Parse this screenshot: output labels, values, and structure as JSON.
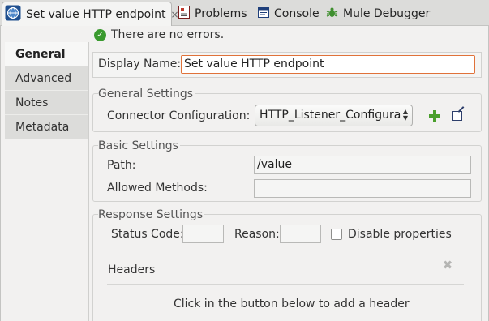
{
  "tabs": [
    {
      "label": "Set value HTTP endpoint",
      "icon": "globe-icon",
      "close": "×"
    },
    {
      "label": "Problems",
      "icon": "problems-icon"
    },
    {
      "label": "Console",
      "icon": "console-icon"
    },
    {
      "label": "Mule Debugger",
      "icon": "bug-icon"
    }
  ],
  "status": {
    "text": "There are no errors.",
    "icon": "check-circle-icon"
  },
  "nav": [
    {
      "label": "General"
    },
    {
      "label": "Advanced"
    },
    {
      "label": "Notes"
    },
    {
      "label": "Metadata"
    }
  ],
  "display_name": {
    "label": "Display Name:",
    "value": "Set value HTTP endpoint"
  },
  "general_settings": {
    "title": "General Settings",
    "connector_label": "Connector Configuration:",
    "connector_value": "HTTP_Listener_Configura",
    "spin_up": "▲",
    "spin_down": "▼"
  },
  "basic_settings": {
    "title": "Basic Settings",
    "path_label": "Path:",
    "path_value": "/value",
    "methods_label": "Allowed Methods:",
    "methods_value": ""
  },
  "response_settings": {
    "title": "Response Settings",
    "status_label": "Status Code:",
    "status_value": "",
    "reason_label": "Reason:",
    "reason_value": "",
    "disable_label": "Disable properties",
    "disable_checked": false,
    "headers_label": "Headers",
    "headers_hint": "Click in the button below to add a header"
  },
  "colors": {
    "accent_focus": "#e0723a",
    "ok_green": "#3a9a2f",
    "add_green": "#4a9f2c"
  }
}
